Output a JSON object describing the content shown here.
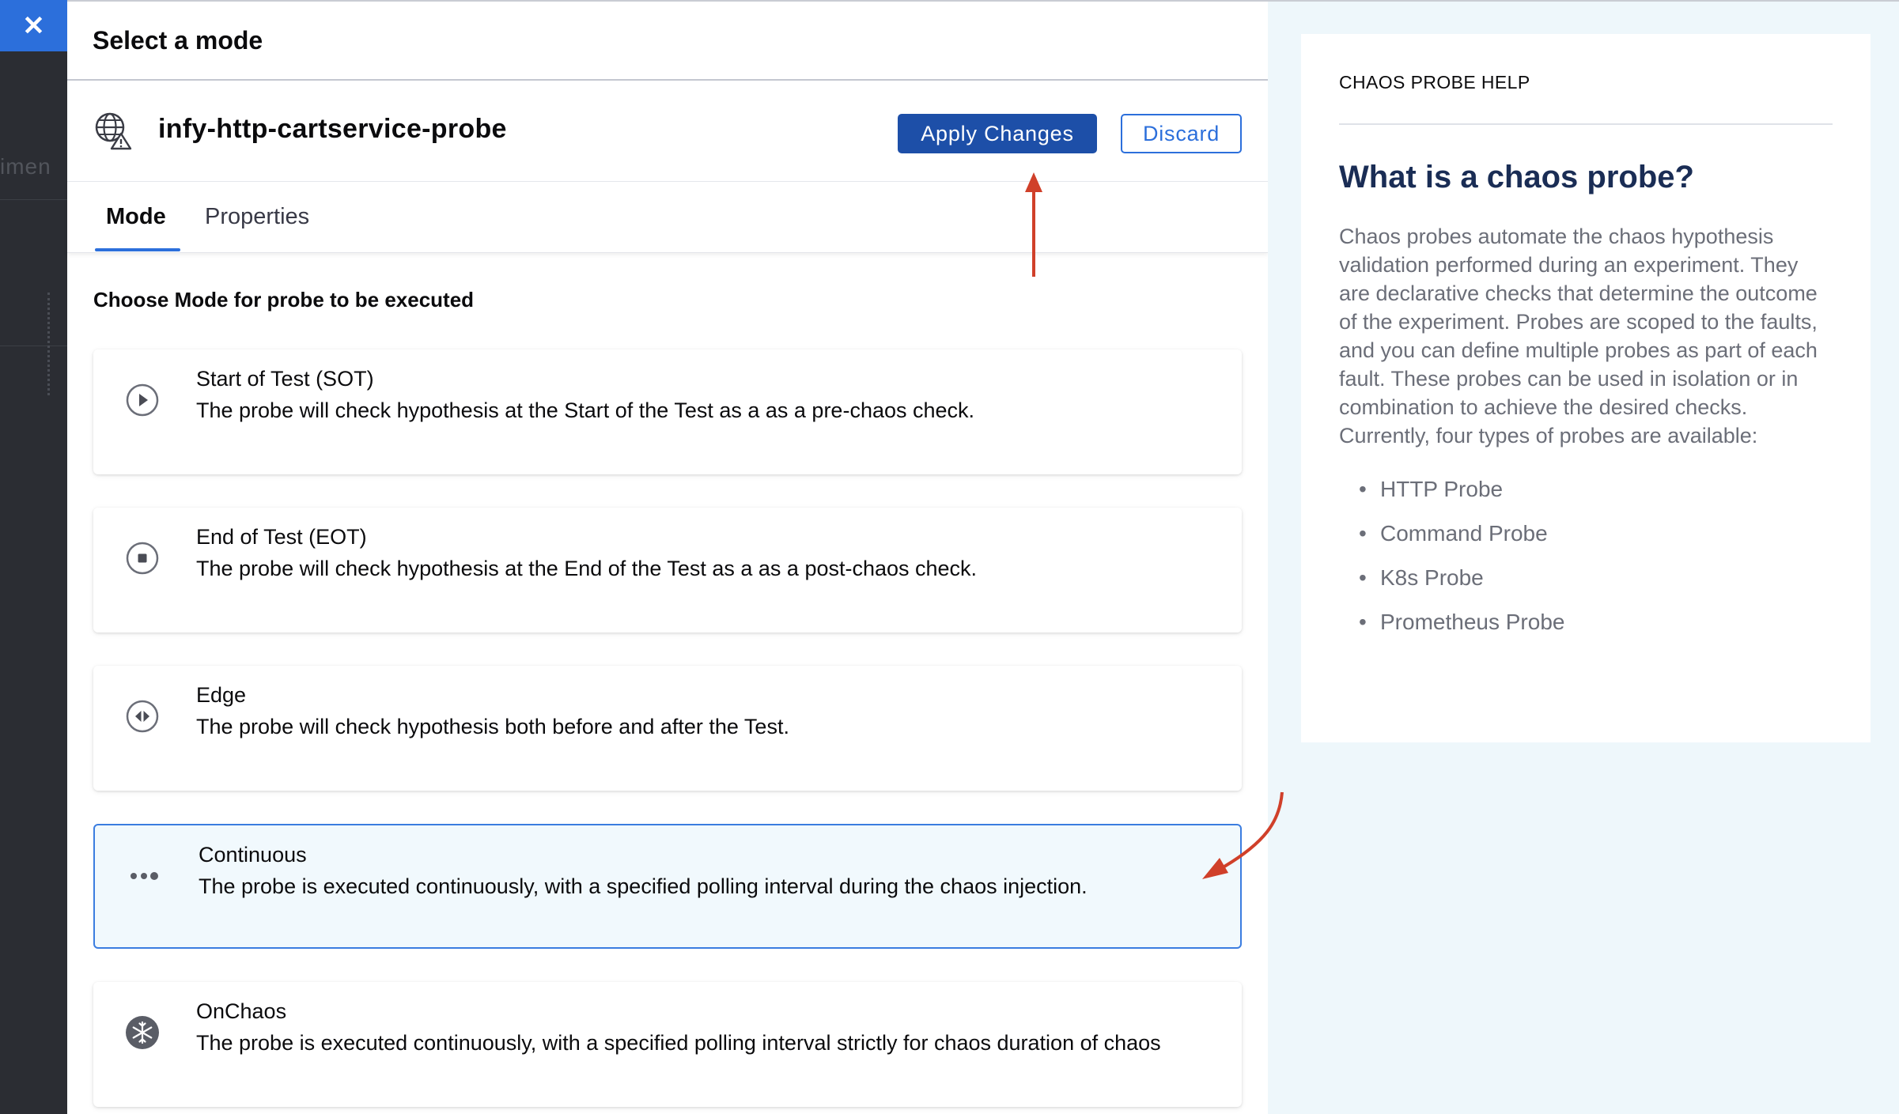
{
  "close_button": {
    "icon": "close-icon"
  },
  "panel": {
    "title": "Select a mode",
    "probe": {
      "name": "infy-http-cartservice-probe",
      "icon": "globe-warning-icon",
      "apply_label": "Apply Changes",
      "discard_label": "Discard"
    },
    "tabs": [
      {
        "label": "Mode",
        "active": true
      },
      {
        "label": "Properties",
        "active": false
      }
    ],
    "section_title": "Choose Mode for probe to be executed",
    "modes": [
      {
        "name": "Start of Test (SOT)",
        "description": "The probe will check hypothesis at the Start of the Test as a as a pre-chaos check.",
        "icon": "play-circle-icon",
        "selected": false
      },
      {
        "name": "End of Test (EOT)",
        "description": "The probe will check hypothesis at the End of the Test as a as a post-chaos check.",
        "icon": "stop-circle-icon",
        "selected": false
      },
      {
        "name": "Edge",
        "description": "The probe will check hypothesis both before and after the Test.",
        "icon": "edge-circle-icon",
        "selected": false
      },
      {
        "name": "Continuous",
        "description": "The probe is executed continuously, with a specified polling interval during the chaos injection.",
        "icon": "dots-icon",
        "selected": true
      },
      {
        "name": "OnChaos",
        "description": "The probe is executed continuously, with a specified polling interval strictly for chaos duration of chaos",
        "icon": "snowflake-icon",
        "selected": false
      }
    ]
  },
  "help": {
    "label": "CHAOS PROBE HELP",
    "heading": "What is a chaos probe?",
    "body": "Chaos probes automate the chaos hypothesis validation performed during an experiment. They are declarative checks that determine the outcome of the experiment. Probes are scoped to the faults, and you can define multiple probes as part of each fault. These probes can be used in isolation or in combination to achieve the desired checks. Currently, four types of probes are available:",
    "items": [
      "HTTP Probe",
      "Command Probe",
      "K8s Probe",
      "Prometheus Probe"
    ]
  },
  "colors": {
    "primary": "#1d4fa8",
    "accent": "#2c6fdb",
    "selected_bg": "#f1f9fd",
    "annotation_arrow": "#d0402a",
    "help_heading": "#1a2d55"
  }
}
